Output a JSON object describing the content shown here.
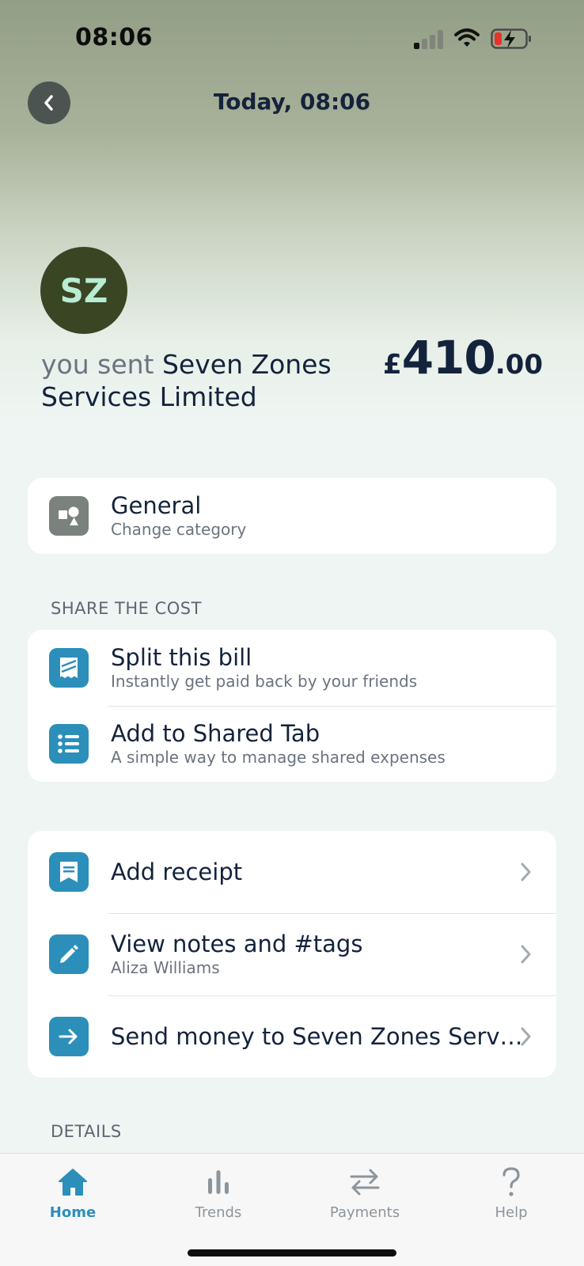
{
  "status_bar": {
    "time": "08:06",
    "icons": [
      "cellular-signal-icon",
      "wifi-icon",
      "battery-charging-icon"
    ],
    "battery_color": "#e5332a"
  },
  "header": {
    "title": "Today, 08:06",
    "back_icon": "chevron-left-icon"
  },
  "transaction": {
    "avatar_initials": "SZ",
    "avatar_bg": "#3a4523",
    "sent_prefix": "you sent",
    "merchant": "Seven Zones Services Limited",
    "amount_currency": "£",
    "amount_whole": "410",
    "amount_decimal": ".00"
  },
  "category": {
    "title": "General",
    "subtitle": "Change category",
    "icon": "category-shapes-icon"
  },
  "share_section": {
    "label": "SHARE THE COST",
    "items": [
      {
        "title": "Split this bill",
        "subtitle": "Instantly get paid back by your friends",
        "icon": "split-bill-icon"
      },
      {
        "title": "Add to Shared Tab",
        "subtitle": "A simple way to manage shared expenses",
        "icon": "list-icon"
      }
    ]
  },
  "actions": {
    "items": [
      {
        "title": "Add receipt",
        "icon": "receipt-icon"
      },
      {
        "title": "View notes and #tags",
        "subtitle": "Aliza Williams",
        "icon": "pencil-icon"
      },
      {
        "title": "Send money to Seven Zones Serv…",
        "icon": "arrow-right-icon"
      }
    ]
  },
  "details_section": {
    "label": "DETAILS"
  },
  "tabbar": {
    "active_color": "#2b8fba",
    "tabs": [
      {
        "label": "Home",
        "icon": "home-icon",
        "active": true
      },
      {
        "label": "Trends",
        "icon": "bar-chart-icon",
        "active": false
      },
      {
        "label": "Payments",
        "icon": "transfer-arrows-icon",
        "active": false
      },
      {
        "label": "Help",
        "icon": "question-mark-icon",
        "active": false
      }
    ]
  }
}
